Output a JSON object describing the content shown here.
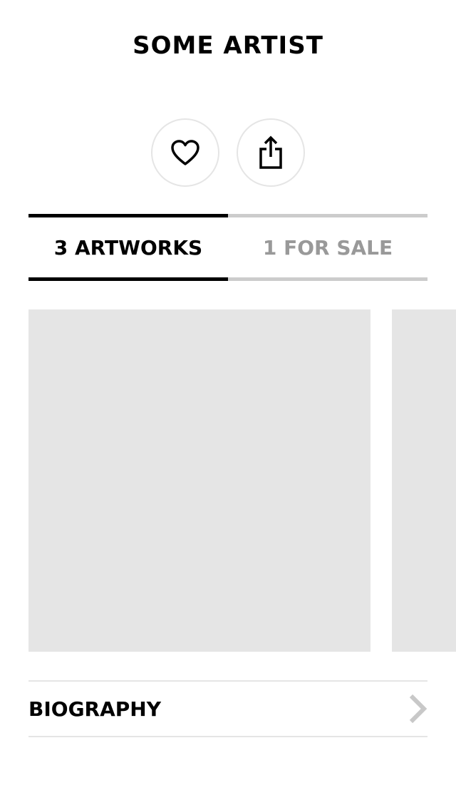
{
  "header": {
    "artist_name": "SOME ARTIST"
  },
  "actions": {
    "follow_icon": "heart-icon",
    "share_icon": "share-icon"
  },
  "tabs": [
    {
      "label": "3 ARTWORKS",
      "active": true
    },
    {
      "label": "1 FOR SALE",
      "active": false
    }
  ],
  "artworks": {
    "placeholder_color": "#e5e5e5"
  },
  "biography": {
    "label": "BIOGRAPHY",
    "chevron_icon": "chevron-right-icon"
  },
  "colors": {
    "text_primary": "#000000",
    "text_inactive": "#999999",
    "divider": "#e5e5e5",
    "tab_inactive_border": "#cccccc"
  }
}
